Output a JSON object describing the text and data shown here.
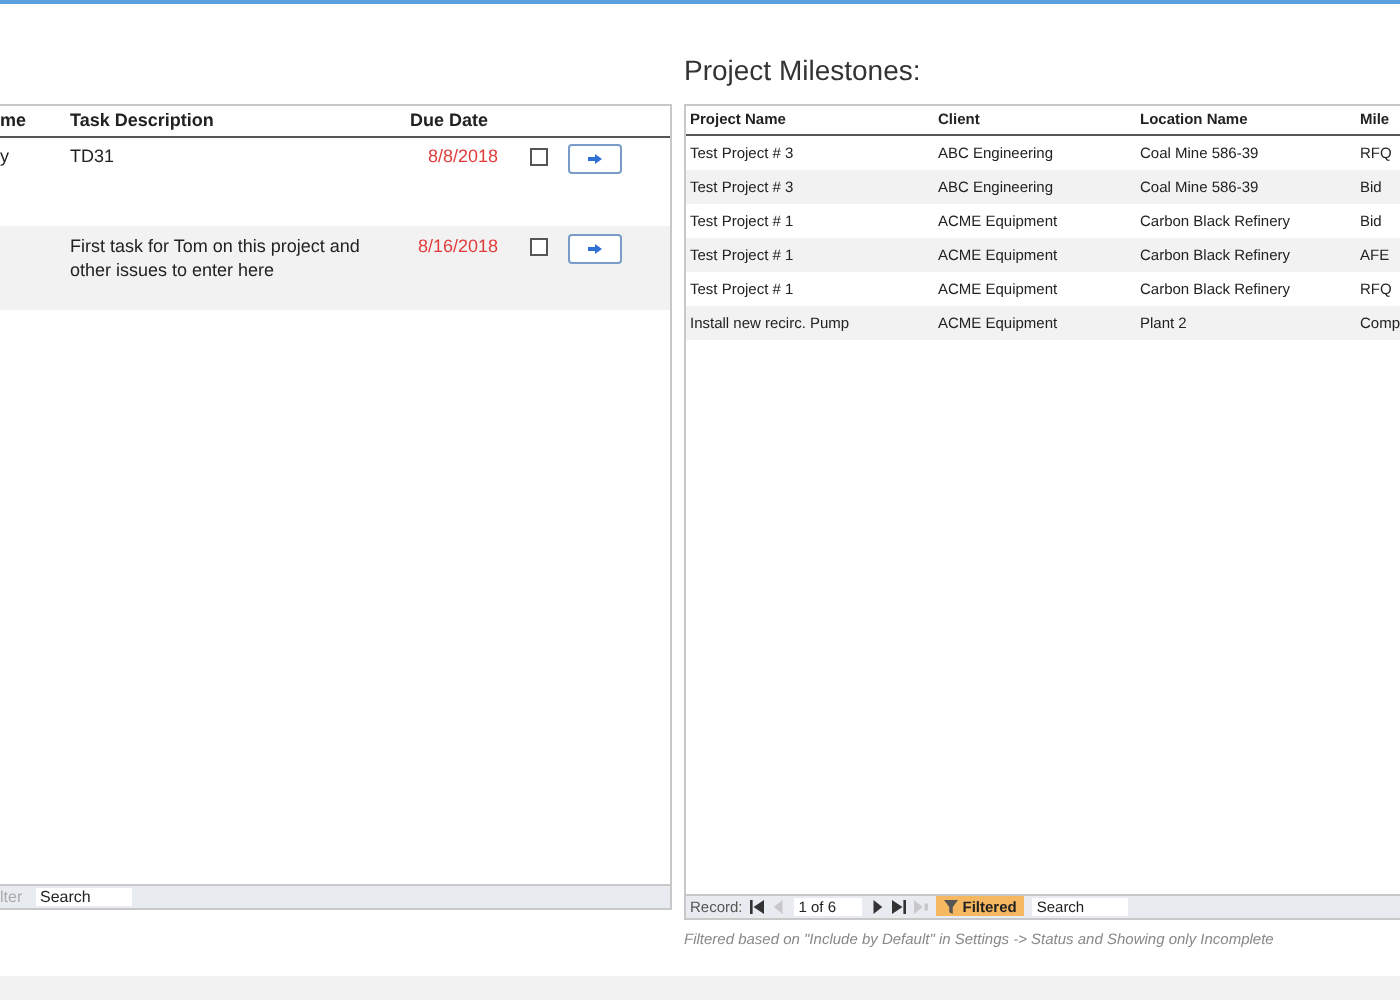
{
  "tasks": {
    "columns": [
      "me",
      "Task Description",
      "Due Date"
    ],
    "rows": [
      {
        "cells": [
          "y",
          "TD31",
          "8/8/2018"
        ],
        "done": false
      },
      {
        "cells": [
          "",
          "First task for Tom on this project and other issues to enter here",
          "8/16/2018"
        ],
        "done": false
      }
    ],
    "footer": {
      "filter": "lter",
      "placeholder": "Search"
    }
  },
  "milestones": {
    "title": "Project Milestones:",
    "columns": [
      "Project Name",
      "Client",
      "Location Name",
      "Mile"
    ],
    "rows": [
      [
        "Test Project # 3",
        "ABC Engineering",
        "Coal Mine 586-39",
        "RFQ"
      ],
      [
        "Test Project # 3",
        "ABC Engineering",
        "Coal Mine 586-39",
        "Bid"
      ],
      [
        "Test Project # 1",
        "ACME Equipment",
        "Carbon Black Refinery",
        "Bid"
      ],
      [
        "Test Project # 1",
        "ACME Equipment",
        "Carbon Black Refinery",
        "AFE"
      ],
      [
        "Test Project # 1",
        "ACME Equipment",
        "Carbon Black Refinery",
        "RFQ"
      ],
      [
        "Install new recirc. Pump",
        "ACME Equipment",
        "Plant 2",
        "Comp"
      ]
    ],
    "footer": {
      "record_label": "Record:",
      "position": "1 of 6",
      "filter": "Filtered",
      "placeholder": "Search"
    },
    "note": "Filtered based on \"Include by Default\" in Settings -> Status and Showing only Incomplete"
  }
}
